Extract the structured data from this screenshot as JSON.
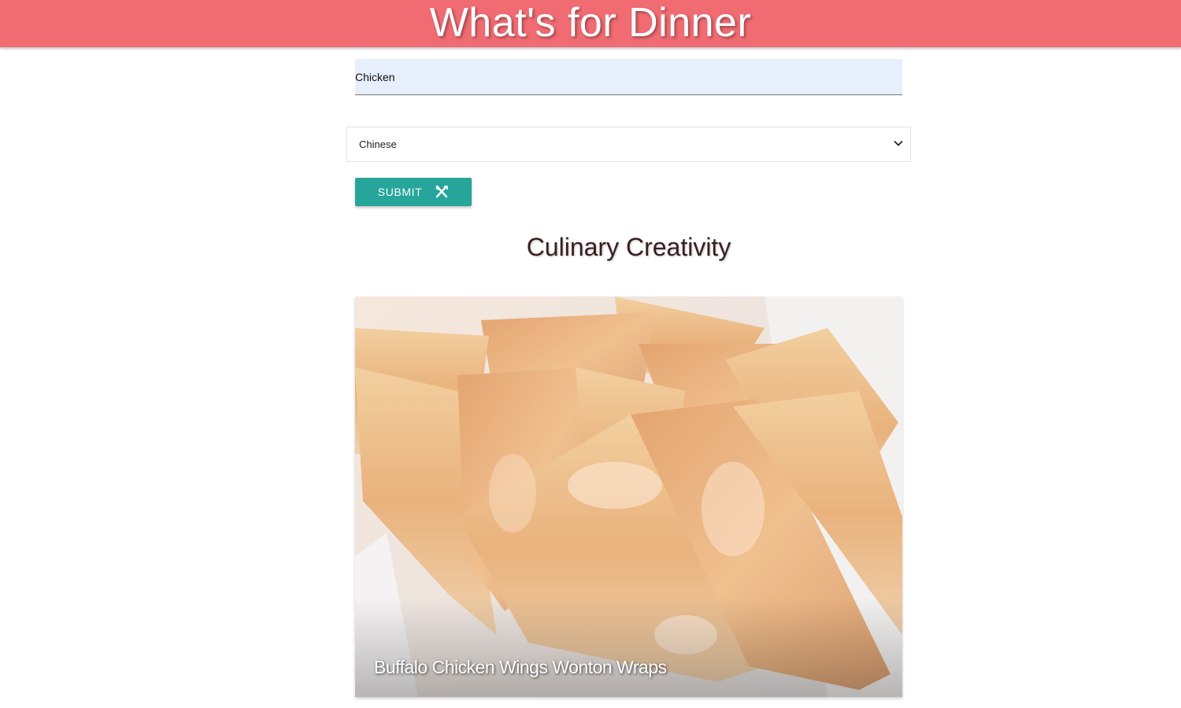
{
  "header": {
    "title": "What's for Dinner"
  },
  "search": {
    "value": "Chicken"
  },
  "cuisine_select": {
    "selected": "Chinese"
  },
  "submit": {
    "label": "SUBMIT",
    "icon": "fork-knife-icon"
  },
  "results": {
    "title": "Culinary Creativity",
    "cards": [
      {
        "title": "Buffalo Chicken Wings Wonton Wraps"
      }
    ]
  },
  "colors": {
    "header_bg": "#f06b72",
    "button_bg": "#26a69a",
    "input_bg": "#e8effc"
  }
}
